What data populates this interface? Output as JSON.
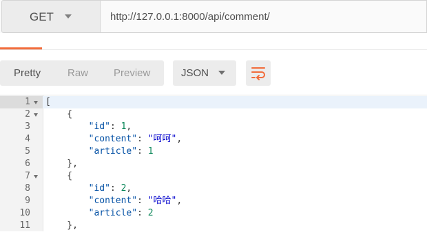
{
  "request": {
    "method": "GET",
    "url": "http://127.0.0.1:8000/api/comment/"
  },
  "toolbar": {
    "views": [
      "Pretty",
      "Raw",
      "Preview"
    ],
    "active_view": "Pretty",
    "format": "JSON",
    "wrap_icon": "wrap-lines-icon"
  },
  "colors": {
    "accent": "#f26b3a",
    "active_line": "#eaf2fb"
  },
  "editor": {
    "active_line": 1,
    "lines": [
      {
        "num": "1",
        "fold": true,
        "segments": [
          {
            "t": "p",
            "v": "["
          }
        ]
      },
      {
        "num": "2",
        "fold": true,
        "segments": [
          {
            "t": "p",
            "v": "    {"
          }
        ]
      },
      {
        "num": "3",
        "fold": false,
        "segments": [
          {
            "t": "p",
            "v": "        "
          },
          {
            "t": "k",
            "v": "\"id\""
          },
          {
            "t": "p",
            "v": ": "
          },
          {
            "t": "n",
            "v": "1"
          },
          {
            "t": "p",
            "v": ","
          }
        ]
      },
      {
        "num": "4",
        "fold": false,
        "segments": [
          {
            "t": "p",
            "v": "        "
          },
          {
            "t": "k",
            "v": "\"content\""
          },
          {
            "t": "p",
            "v": ": "
          },
          {
            "t": "s",
            "v": "\"呵呵\""
          },
          {
            "t": "p",
            "v": ","
          }
        ]
      },
      {
        "num": "5",
        "fold": false,
        "segments": [
          {
            "t": "p",
            "v": "        "
          },
          {
            "t": "k",
            "v": "\"article\""
          },
          {
            "t": "p",
            "v": ": "
          },
          {
            "t": "n",
            "v": "1"
          }
        ]
      },
      {
        "num": "6",
        "fold": false,
        "segments": [
          {
            "t": "p",
            "v": "    },"
          }
        ]
      },
      {
        "num": "7",
        "fold": true,
        "segments": [
          {
            "t": "p",
            "v": "    {"
          }
        ]
      },
      {
        "num": "8",
        "fold": false,
        "segments": [
          {
            "t": "p",
            "v": "        "
          },
          {
            "t": "k",
            "v": "\"id\""
          },
          {
            "t": "p",
            "v": ": "
          },
          {
            "t": "n",
            "v": "2"
          },
          {
            "t": "p",
            "v": ","
          }
        ]
      },
      {
        "num": "9",
        "fold": false,
        "segments": [
          {
            "t": "p",
            "v": "        "
          },
          {
            "t": "k",
            "v": "\"content\""
          },
          {
            "t": "p",
            "v": ": "
          },
          {
            "t": "s",
            "v": "\"哈哈\""
          },
          {
            "t": "p",
            "v": ","
          }
        ]
      },
      {
        "num": "10",
        "fold": false,
        "segments": [
          {
            "t": "p",
            "v": "        "
          },
          {
            "t": "k",
            "v": "\"article\""
          },
          {
            "t": "p",
            "v": ": "
          },
          {
            "t": "n",
            "v": "2"
          }
        ]
      },
      {
        "num": "11",
        "fold": false,
        "segments": [
          {
            "t": "p",
            "v": "    },"
          }
        ]
      }
    ]
  }
}
